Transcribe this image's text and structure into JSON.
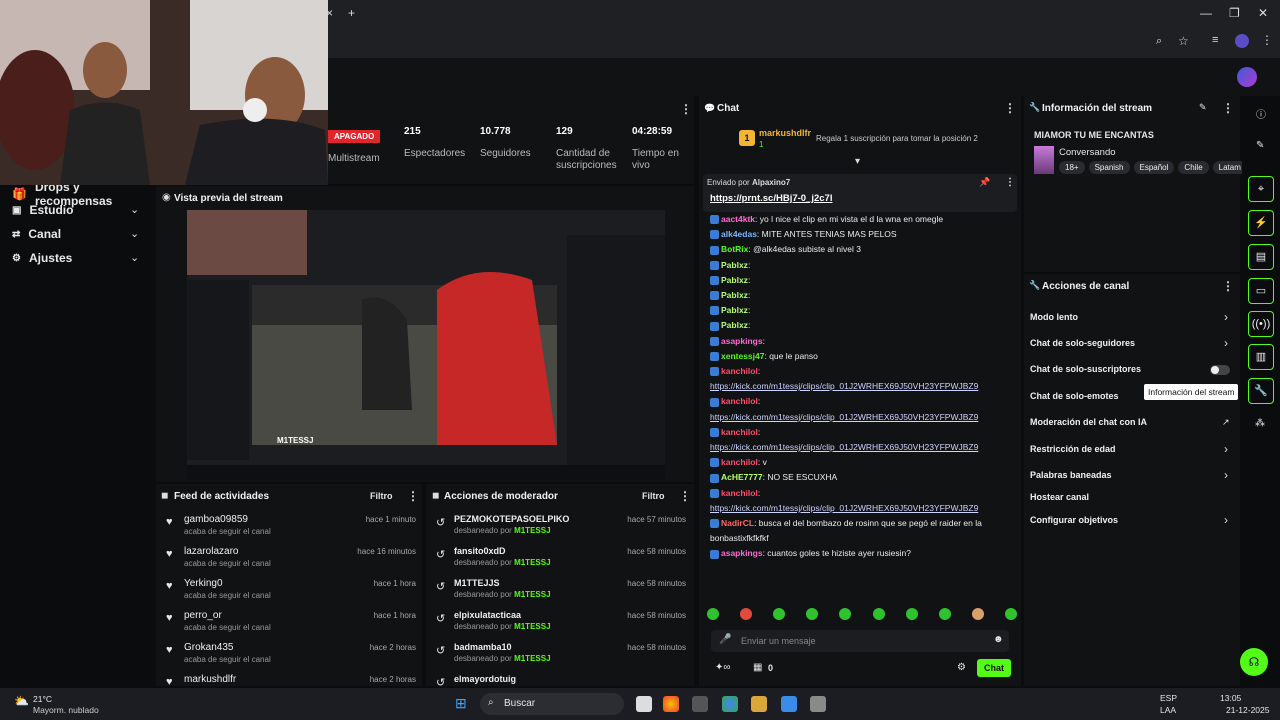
{
  "browser": {
    "new_tab": "+",
    "close_tab": "×"
  },
  "nav": {
    "drops": "Drops y recompensas",
    "estudio": "Estudio",
    "canal": "Canal",
    "ajustes": "Ajustes"
  },
  "stats": {
    "status": "APAGADO",
    "multistream": "Multistream",
    "viewers_v": "215",
    "viewers_l": "Espectadores",
    "followers_v": "10.778",
    "followers_l": "Seguidores",
    "subs_v": "129",
    "subs_l": "Cantidad de suscripciones",
    "time_v": "04:28:59",
    "time_l": "Tiempo en vivo"
  },
  "preview": {
    "title": "Vista previa del stream",
    "channel": "M1TESSJ"
  },
  "feed": {
    "title": "Feed de actividades",
    "filter": "Filtro",
    "items": [
      {
        "name": "gamboa09859",
        "sub": "acaba de seguir el canal",
        "time": "hace 1 minuto"
      },
      {
        "name": "lazarolazaro",
        "sub": "acaba de seguir el canal",
        "time": "hace 16 minutos"
      },
      {
        "name": "Yerking0",
        "sub": "acaba de seguir el canal",
        "time": "hace 1 hora"
      },
      {
        "name": "perro_or",
        "sub": "acaba de seguir el canal",
        "time": "hace 1 hora"
      },
      {
        "name": "Grokan435",
        "sub": "acaba de seguir el canal",
        "time": "hace 2 horas"
      },
      {
        "name": "markushdlfr",
        "sub": "",
        "time": "hace 2 horas"
      }
    ]
  },
  "mod": {
    "title": "Acciones de moderador",
    "filter": "Filtro",
    "items": [
      {
        "name": "PEZMOKOTEPASOELPIKO",
        "sub": "desbaneado por",
        "by": "M1TESSJ",
        "time": "hace 57 minutos"
      },
      {
        "name": "fansito0xdD",
        "sub": "desbaneado por",
        "by": "M1TESSJ",
        "time": "hace 58 minutos"
      },
      {
        "name": "M1TTEJJS",
        "sub": "desbaneado por",
        "by": "M1TESSJ",
        "time": "hace 58 minutos"
      },
      {
        "name": "elpixulatacticaa",
        "sub": "desbaneado por",
        "by": "M1TESSJ",
        "time": "hace 58 minutos"
      },
      {
        "name": "badmamba10",
        "sub": "desbaneado por",
        "by": "M1TESSJ",
        "time": "hace 58 minutos"
      },
      {
        "name": "elmayordotuig",
        "sub": "",
        "by": "",
        "time": ""
      }
    ]
  },
  "chat": {
    "title": "Chat",
    "top_user": "markushdlfr",
    "top_rank": "1",
    "top_count": "1",
    "gift_text": "Regala 1 suscripción para tomar la posición 2",
    "pinned_by_label": "Enviado por",
    "pinned_by": "Alpaxino7",
    "pinned_link": "https://prnt.sc/HBj7-0_j2c7l",
    "lines": [
      {
        "user": "aact4ktk",
        "color": "#ff6ad5",
        "text": ": yo l nice el clip en mi vista el d la wna en omegle",
        "link": false
      },
      {
        "user": "alk4edas",
        "color": "#7ab6ff",
        "text": ": MITE ANTES TENIAS MAS PELOS",
        "link": false
      },
      {
        "user": "BotRix",
        "color": "#53fc18",
        "text": ": @alk4edas subiste al nivel 3",
        "link": false
      },
      {
        "user": "Pablxz",
        "color": "#b5ff6b",
        "text": ":",
        "link": false
      },
      {
        "user": "Pablxz",
        "color": "#b5ff6b",
        "text": ":",
        "link": false
      },
      {
        "user": "Pablxz",
        "color": "#b5ff6b",
        "text": ":",
        "link": false
      },
      {
        "user": "Pablxz",
        "color": "#b5ff6b",
        "text": ":",
        "link": false
      },
      {
        "user": "Pablxz",
        "color": "#b5ff6b",
        "text": ":",
        "link": false
      },
      {
        "user": "asapkings",
        "color": "#ff6ad5",
        "text": ":",
        "link": false
      },
      {
        "user": "xentessj47",
        "color": "#53fc18",
        "text": ": que le panso",
        "link": false
      },
      {
        "user": "kanchilol",
        "color": "#ff4d6d",
        "text": ":",
        "link": false
      },
      {
        "user": "",
        "color": "",
        "text": "https://kick.com/m1tessj/clips/clip_01J2WRHEX69J50VH23YFPWJBZ9",
        "link": true
      },
      {
        "user": "kanchilol",
        "color": "#ff4d6d",
        "text": ":",
        "link": false
      },
      {
        "user": "",
        "color": "",
        "text": "https://kick.com/m1tessj/clips/clip_01J2WRHEX69J50VH23YFPWJBZ9",
        "link": true
      },
      {
        "user": "kanchilol",
        "color": "#ff4d6d",
        "text": ":",
        "link": false
      },
      {
        "user": "",
        "color": "",
        "text": "https://kick.com/m1tessj/clips/clip_01J2WRHEX69J50VH23YFPWJBZ9",
        "link": true
      },
      {
        "user": "kanchilol",
        "color": "#ff4d6d",
        "text": ": v",
        "link": false
      },
      {
        "user": "AcHE7777",
        "color": "#b5ff6b",
        "text": ": NO SE ESCUXHA",
        "link": false
      },
      {
        "user": "kanchilol",
        "color": "#ff4d6d",
        "text": ":",
        "link": false
      },
      {
        "user": "",
        "color": "",
        "text": "https://kick.com/m1tessj/clips/clip_01J2WRHEX69J50VH23YFPWJBZ9",
        "link": true
      },
      {
        "user": "NadirCL",
        "color": "#ff6a6a",
        "text": ": busca el del bombazo de rosinn que se pegó el raider en la",
        "link": false
      },
      {
        "user": "",
        "color": "",
        "text": "bonbastixfkfkfkf",
        "link": false
      },
      {
        "user": "asapkings",
        "color": "#ff6ad5",
        "text": ": cuantos goles te hiziste ayer rusiesin?",
        "link": false
      }
    ],
    "input_placeholder": "Enviar un mensaje",
    "count": "0",
    "send": "Chat"
  },
  "info": {
    "title": "Información del stream",
    "stream_title": "MIAMOR TU ME ENCANTAS",
    "category": "Conversando",
    "tags": [
      "18+",
      "Spanish",
      "Español",
      "Chile",
      "Latam"
    ]
  },
  "actions": {
    "title": "Acciones de canal",
    "tooltip": "Información del stream",
    "items": [
      "Modo lento",
      "Chat de solo-seguidores",
      "Chat de solo-suscriptores",
      "Chat de solo-emotes",
      "Moderación del chat con IA",
      "Restricción de edad",
      "Palabras baneadas",
      "Hostear canal",
      "Configurar objetivos"
    ]
  },
  "taskbar": {
    "temp": "21°C",
    "weather": "Mayorm. nublado",
    "search": "Buscar",
    "lang": "ESP",
    "lang2": "LAA",
    "time": "13:05",
    "date": "21-12-2025"
  },
  "colors": {
    "accent": "#53fc18",
    "panel": "#111214",
    "bg": "#0b0c0e"
  }
}
